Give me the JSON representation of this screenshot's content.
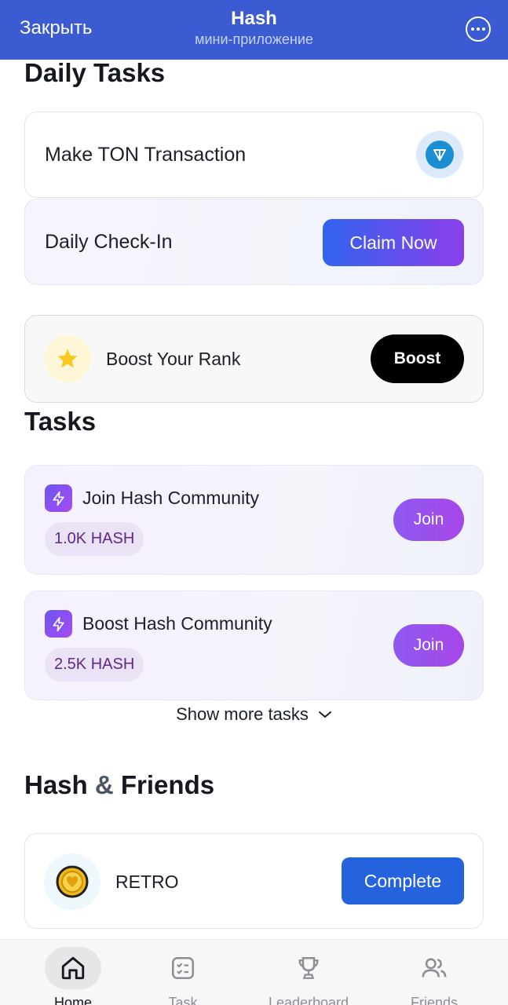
{
  "topbar": {
    "close_label": "Закрыть",
    "title": "Hash",
    "subtitle": "мини-приложение"
  },
  "daily": {
    "title": "Daily Tasks",
    "ton_label": "Make TON Transaction",
    "checkin_label": "Daily Check-In",
    "claim_label": "Claim Now",
    "boost_label": "Boost Your Rank",
    "boost_button": "Boost"
  },
  "tasks": {
    "title": "Tasks",
    "items": [
      {
        "title": "Join Hash Community",
        "reward": "1.0K HASH",
        "button": "Join"
      },
      {
        "title": "Boost Hash Community",
        "reward": "2.5K HASH",
        "button": "Join"
      }
    ],
    "show_more": "Show more tasks"
  },
  "friends": {
    "title_part1": "Hash",
    "title_amp": "&",
    "title_part2": "Friends",
    "item_label": "RETRO",
    "item_button": "Complete"
  },
  "nav": [
    {
      "label": "Home",
      "icon": "home-icon",
      "active": true
    },
    {
      "label": "Task",
      "icon": "checklist-icon",
      "active": false
    },
    {
      "label": "Leaderboard",
      "icon": "trophy-icon",
      "active": false
    },
    {
      "label": "Friends",
      "icon": "users-icon",
      "active": false
    }
  ],
  "colors": {
    "header": "#3a5bd1",
    "accent_blue": "#2463dd",
    "accent_purple": "#8b40ec"
  }
}
